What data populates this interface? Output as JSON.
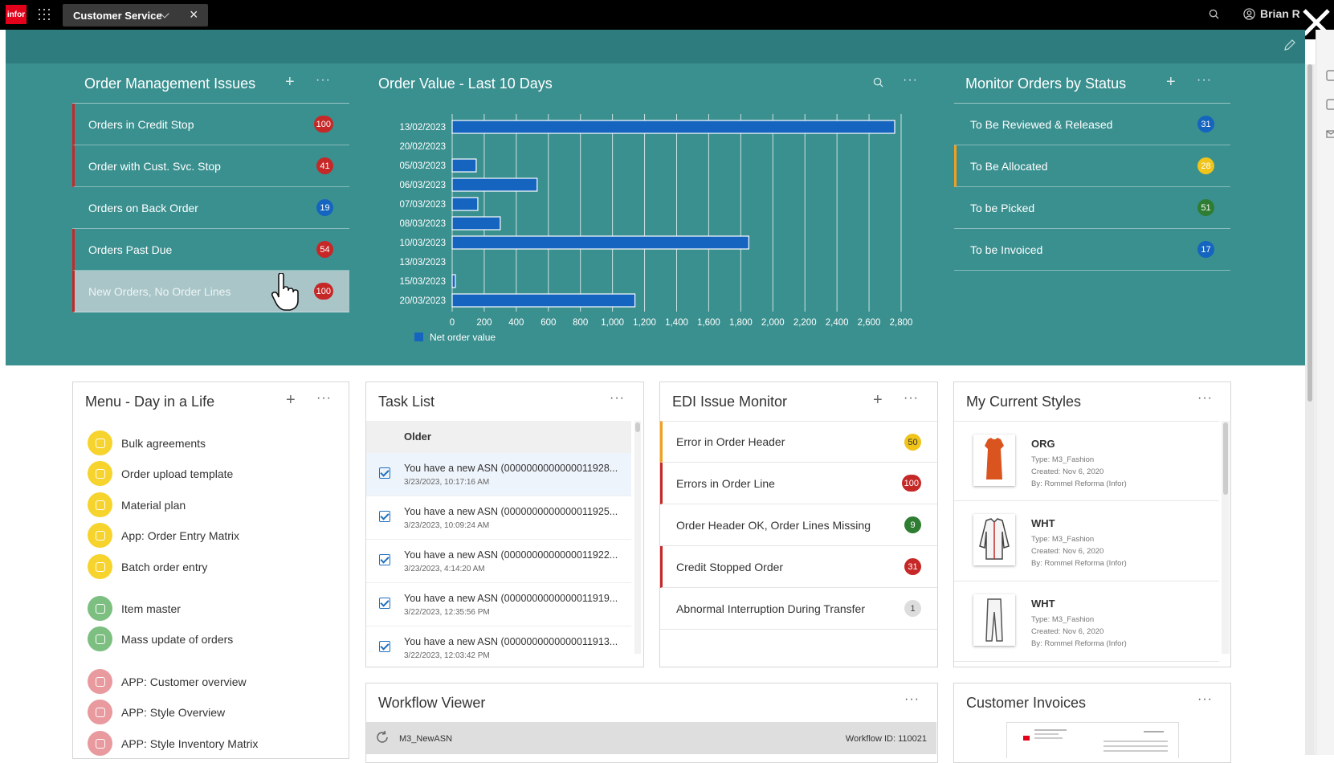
{
  "topbar": {
    "logo": "infor",
    "tab_label": "Customer Service",
    "user_name": "Brian R"
  },
  "order_mgmt": {
    "title": "Order Management Issues",
    "items": [
      {
        "label": "Orders in Credit Stop",
        "count": "100",
        "accent": "#c62828"
      },
      {
        "label": "Order with Cust. Svc. Stop",
        "count": "41",
        "accent": "#c62828"
      },
      {
        "label": "Orders on Back Order",
        "count": "19",
        "accent": ""
      },
      {
        "label": "Orders Past Due",
        "count": "54",
        "accent": "#c62828"
      },
      {
        "label": "New Orders, No Order Lines",
        "count": "100",
        "accent": "#c62828"
      }
    ]
  },
  "chart_title": "Order Value - Last 10 Days",
  "chart_data": {
    "type": "bar",
    "orientation": "horizontal",
    "categories": [
      "13/02/2023",
      "20/02/2023",
      "05/03/2023",
      "06/03/2023",
      "07/03/2023",
      "08/03/2023",
      "10/03/2023",
      "13/03/2023",
      "15/03/2023",
      "20/03/2023"
    ],
    "series": [
      {
        "name": "Net order value",
        "values": [
          2760,
          0,
          150,
          530,
          160,
          300,
          1850,
          0,
          20,
          1140
        ],
        "color": "#1565c0"
      }
    ],
    "xlim": [
      0,
      2800
    ],
    "x_ticks": [
      "0",
      "200",
      "400",
      "600",
      "800",
      "1,000",
      "1,200",
      "1,400",
      "1,600",
      "1,800",
      "2,000",
      "2,200",
      "2,400",
      "2,600",
      "2,800"
    ],
    "grid": true,
    "legend": "bottom-left"
  },
  "monitor": {
    "title": "Monitor Orders by Status",
    "items": [
      {
        "label": "To Be Reviewed & Released",
        "count": "31",
        "color": "#1565c0"
      },
      {
        "label": "To Be Allocated",
        "count": "28",
        "color": "#f0c419"
      },
      {
        "label": "To be Picked",
        "count": "51",
        "color": "#2e7d32"
      },
      {
        "label": "To be Invoiced",
        "count": "17",
        "color": "#1565c0"
      }
    ]
  },
  "menu": {
    "title": "Menu - Day in a Life",
    "items": [
      {
        "label": "Bulk agreements",
        "icon": "star-icon"
      },
      {
        "label": "Order upload template",
        "icon": "template-icon"
      },
      {
        "label": "Material plan",
        "icon": "pin-icon"
      },
      {
        "label": "App: Order Entry Matrix",
        "icon": "globe-icon"
      },
      {
        "label": "Batch order entry",
        "icon": "batch-icon"
      },
      {
        "label": "Item master",
        "icon": "box-icon"
      },
      {
        "label": "Mass update of orders",
        "icon": "user-icon"
      },
      {
        "label": "APP: Customer overview",
        "icon": "pin-icon"
      },
      {
        "label": "APP: Style Overview",
        "icon": "globe-icon"
      },
      {
        "label": "APP: Style Inventory Matrix",
        "icon": "globe-icon"
      }
    ]
  },
  "tasks": {
    "title": "Task List",
    "group": "Older",
    "items": [
      {
        "text": "You have a new ASN (0000000000000011928...",
        "time": "3/23/2023, 10:17:16 AM"
      },
      {
        "text": "You have a new ASN (0000000000000011925...",
        "time": "3/23/2023, 10:09:24 AM"
      },
      {
        "text": "You have a new ASN (0000000000000011922...",
        "time": "3/23/2023, 4:14:20 AM"
      },
      {
        "text": "You have a new ASN (0000000000000011919...",
        "time": "3/22/2023, 12:35:56 PM"
      },
      {
        "text": "You have a new ASN (0000000000000011913...",
        "time": "3/22/2023, 12:03:42 PM"
      }
    ]
  },
  "edi": {
    "title": "EDI Issue Monitor",
    "items": [
      {
        "label": "Error in Order Header",
        "count": "50"
      },
      {
        "label": "Errors in Order Line",
        "count": "100"
      },
      {
        "label": "Order Header OK, Order Lines Missing",
        "count": "9"
      },
      {
        "label": "Credit Stopped Order",
        "count": "31"
      },
      {
        "label": "Abnormal Interruption During Transfer",
        "count": "1"
      }
    ]
  },
  "styles": {
    "title": "My Current Styles",
    "items": [
      {
        "name": "ORG",
        "type": "Type: M3_Fashion",
        "created": "Created: Nov 6, 2020",
        "by": "By: Rommel Reforma (Infor)"
      },
      {
        "name": "WHT",
        "type": "Type: M3_Fashion",
        "created": "Created: Nov 6, 2020",
        "by": "By: Rommel Reforma (Infor)"
      },
      {
        "name": "WHT",
        "type": "Type: M3_Fashion",
        "created": "Created: Nov 6, 2020",
        "by": "By: Rommel Reforma (Infor)"
      }
    ]
  },
  "workflow": {
    "title": "Workflow Viewer",
    "name": "M3_NewASN",
    "id_label": "Workflow ID: 110021"
  },
  "invoices": {
    "title": "Customer Invoices"
  }
}
